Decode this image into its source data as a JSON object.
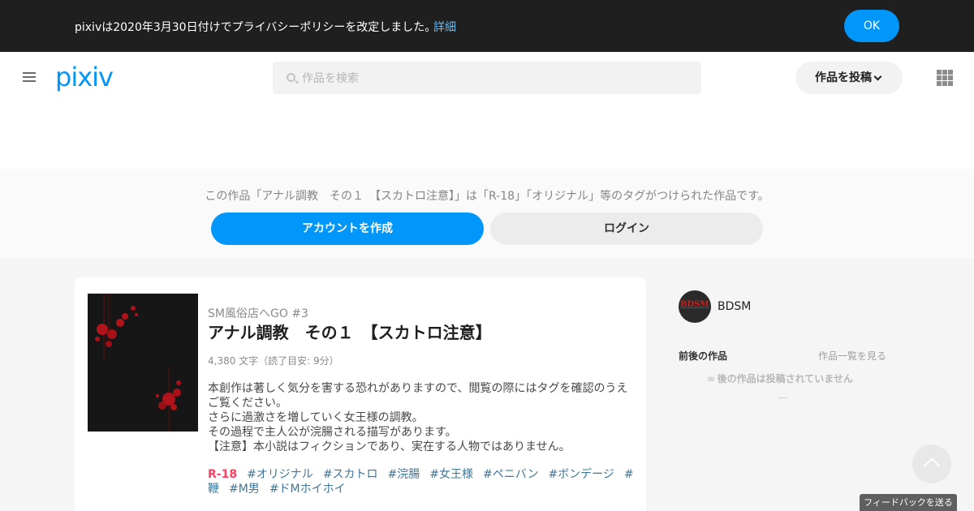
{
  "notice": {
    "text": "pixivは2020年3月30日付けでプライバシーポリシーを改定しました。",
    "link": "詳細",
    "ok": "OK"
  },
  "header": {
    "logo": "pixiv",
    "search_placeholder": "作品を検索",
    "post_label": "作品を投稿"
  },
  "tagbar": {
    "text": "この作品「アナル調教　その１　【スカトロ注意】」は「R-18」「オリジナル」等のタグがつけられた作品です。",
    "create_account": "アカウントを作成",
    "login": "ログイン"
  },
  "novel": {
    "series": "SM風俗店へGO #3",
    "title": "アナル調教　その１　【スカトロ注意】",
    "meta": "4,380 文字（読了目安: 9分）",
    "description": [
      "本創作は著しく気分を害する恐れがありますので、閲覧の際にはタグを確認のうえご覧ください。",
      "さらに過激さを増していく女王様の調教。",
      "その過程で主人公が浣腸される描写があります。",
      "【注意】本小説はフィクションであり、実在する人物ではありません。"
    ],
    "rating_tag": "R-18",
    "tags": [
      "#オリジナル",
      "#スカトロ",
      "#浣腸",
      "#女王様",
      "#ペニバン",
      "#ボンデージ",
      "#鞭",
      "#M男",
      "#ドMホイホイ"
    ]
  },
  "sidebar": {
    "user_name": "BDSM",
    "avatar_text": "BDSM",
    "nav_label": "前後の作品",
    "list_link": "作品一覧を見る",
    "empty_text": "後の作品は投稿されていません"
  },
  "feedback": "フィードバックを送る",
  "colors": {
    "accent": "#0096fa",
    "r18": "#ff4060",
    "tag": "#3d7699"
  }
}
